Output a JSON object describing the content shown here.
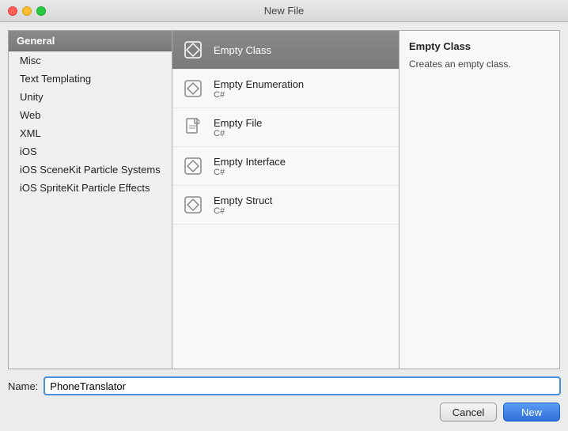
{
  "titleBar": {
    "title": "New File"
  },
  "leftPanel": {
    "header": "General",
    "items": [
      {
        "label": "Misc"
      },
      {
        "label": "Text Templating"
      },
      {
        "label": "Unity"
      },
      {
        "label": "Web"
      },
      {
        "label": "XML"
      },
      {
        "label": "iOS"
      },
      {
        "label": "iOS SceneKit Particle Systems"
      },
      {
        "label": "iOS SpriteKit Particle Effects"
      }
    ]
  },
  "midPanel": {
    "items": [
      {
        "name": "Empty Class",
        "sub": "",
        "selected": true
      },
      {
        "name": "Empty Enumeration",
        "sub": "C#",
        "selected": false
      },
      {
        "name": "Empty File",
        "sub": "C#",
        "selected": false
      },
      {
        "name": "Empty Interface",
        "sub": "C#",
        "selected": false
      },
      {
        "name": "Empty Struct",
        "sub": "C#",
        "selected": false
      }
    ]
  },
  "rightPanel": {
    "title": "Empty Class",
    "description": "Creates an empty class."
  },
  "bottomBar": {
    "nameLabel": "Name:",
    "nameValue": "PhoneTranslator",
    "cancelLabel": "Cancel",
    "newLabel": "New"
  }
}
